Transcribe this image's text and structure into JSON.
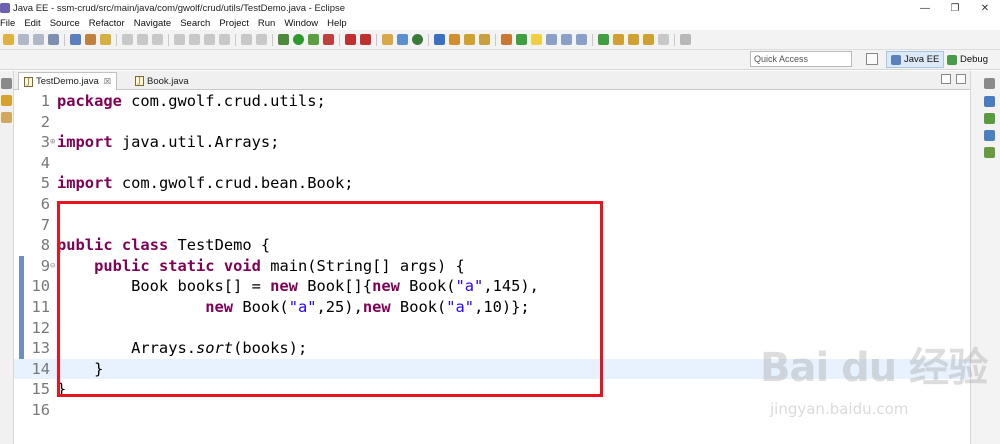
{
  "window": {
    "title": "Java EE - ssm-crud/src/main/java/com/gwolf/crud/utils/TestDemo.java - Eclipse",
    "controls": [
      "—",
      "❐",
      "✕"
    ]
  },
  "menu": [
    "File",
    "Edit",
    "Source",
    "Refactor",
    "Navigate",
    "Search",
    "Project",
    "Run",
    "Window",
    "Help"
  ],
  "quick_access": {
    "placeholder": "Quick Access"
  },
  "perspectives": [
    {
      "label": "Java EE",
      "active": true,
      "icon": "java-ee-icon"
    },
    {
      "label": "Debug",
      "active": false,
      "icon": "bug-icon"
    }
  ],
  "editor_tabs": [
    {
      "label": "TestDemo.java",
      "active": true,
      "close": "☒"
    },
    {
      "label": "Book.java",
      "active": false,
      "close": ""
    }
  ],
  "code": {
    "line_numbers": [
      "1",
      "2",
      "3",
      "4",
      "5",
      "6",
      "7",
      "8",
      "9",
      "10",
      "11",
      "12",
      "13",
      "14",
      "15",
      "16"
    ],
    "current_line": 14,
    "changed_lines": [
      9,
      10,
      11,
      12,
      13,
      14
    ],
    "lines": [
      [
        {
          "t": "package",
          "k": "kw"
        },
        {
          "t": " com.gwolf.crud.utils;",
          "k": "p"
        }
      ],
      [],
      [
        {
          "t": "import",
          "k": "kw"
        },
        {
          "t": " java.util.Arrays;",
          "k": "p"
        }
      ],
      [],
      [
        {
          "t": "import",
          "k": "kw"
        },
        {
          "t": " com.gwolf.crud.bean.Book;",
          "k": "p"
        }
      ],
      [],
      [],
      [
        {
          "t": "public",
          "k": "kw"
        },
        {
          "t": " ",
          "k": "p"
        },
        {
          "t": "class",
          "k": "kw"
        },
        {
          "t": " TestDemo {",
          "k": "p"
        }
      ],
      [
        {
          "t": "    ",
          "k": "p"
        },
        {
          "t": "public",
          "k": "kw"
        },
        {
          "t": " ",
          "k": "p"
        },
        {
          "t": "static",
          "k": "kw"
        },
        {
          "t": " ",
          "k": "p"
        },
        {
          "t": "void",
          "k": "kw"
        },
        {
          "t": " main(String[] args) {",
          "k": "p"
        }
      ],
      [
        {
          "t": "        Book books[] = ",
          "k": "p"
        },
        {
          "t": "new",
          "k": "kw"
        },
        {
          "t": " Book[]{",
          "k": "p"
        },
        {
          "t": "new",
          "k": "kw"
        },
        {
          "t": " Book(",
          "k": "p"
        },
        {
          "t": "\"a\"",
          "k": "str"
        },
        {
          "t": ",145),",
          "k": "p"
        }
      ],
      [
        {
          "t": "                ",
          "k": "p"
        },
        {
          "t": "new",
          "k": "kw"
        },
        {
          "t": " Book(",
          "k": "p"
        },
        {
          "t": "\"a\"",
          "k": "str"
        },
        {
          "t": ",25),",
          "k": "p"
        },
        {
          "t": "new",
          "k": "kw"
        },
        {
          "t": " Book(",
          "k": "p"
        },
        {
          "t": "\"a\"",
          "k": "str"
        },
        {
          "t": ",10)};",
          "k": "p"
        }
      ],
      [],
      [
        {
          "t": "        Arrays.",
          "k": "p"
        },
        {
          "t": "sort",
          "k": "it"
        },
        {
          "t": "(books);",
          "k": "p"
        }
      ],
      [
        {
          "t": "    }",
          "k": "p"
        }
      ],
      [
        {
          "t": "}",
          "k": "p"
        }
      ],
      []
    ],
    "fold_markers": {
      "3": "⊕",
      "9": "⊖"
    }
  },
  "watermark": {
    "logo": "Bai du 经验",
    "url": "jingyan.baidu.com"
  },
  "colors": {
    "keyword": "#7f0055",
    "string": "#2a00ff",
    "current_line": "#e8f2fe",
    "highlight_box": "#e8141f"
  }
}
